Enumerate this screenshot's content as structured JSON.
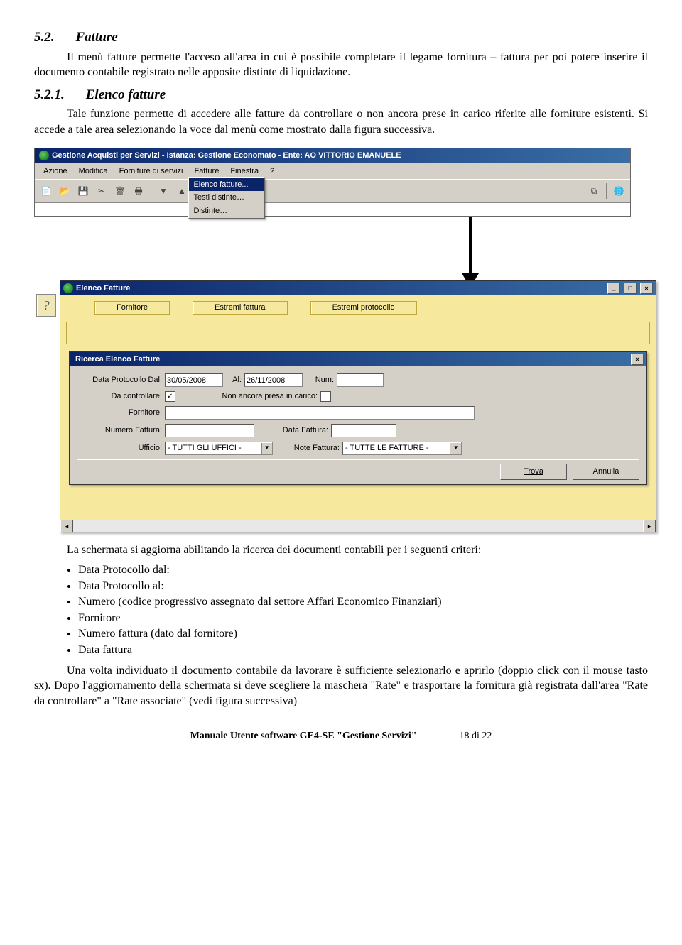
{
  "section": {
    "num": "5.2.",
    "title": "Fatture"
  },
  "para1": "Il menù fatture permette l'acceso all'area in cui è possibile completare il legame fornitura – fattura per poi potere inserire il documento contabile registrato nelle apposite distinte di liquidazione.",
  "subsection": {
    "num": "5.2.1.",
    "title": "Elenco fatture"
  },
  "para2": "Tale funzione permette di accedere alle fatture da controllare o non ancora prese in carico riferite alle forniture esistenti. Si accede a tale area selezionando la voce dal menù come mostrato dalla figura successiva.",
  "app": {
    "title": "Gestione Acquisti per Servizi - Istanza: Gestione Economato - Ente: AO VITTORIO EMANUELE ",
    "menus": [
      "Azione",
      "Modifica",
      "Forniture di servizi",
      "Fatture",
      "Finestra",
      "?"
    ],
    "dropdown": [
      "Elenco fatture...",
      "Testi distinte…",
      "Distinte…"
    ]
  },
  "elenco": {
    "title": "Elenco Fatture",
    "helpIcon": "?",
    "cols": [
      "Fornitore",
      "Estremi fattura",
      "Estremi protocollo"
    ]
  },
  "ricerca": {
    "title": "Ricerca Elenco Fatture",
    "labels": {
      "dataProtDal": "Data Protocollo Dal:",
      "al": "Al:",
      "num": "Num:",
      "daControllare": "Da controllare:",
      "nonPresa": "Non ancora presa in carico:",
      "fornitore": "Fornitore:",
      "numFattura": "Numero Fattura:",
      "dataFattura": "Data Fattura:",
      "ufficio": "Ufficio:",
      "noteFattura": "Note Fattura:"
    },
    "values": {
      "dataProtDal": "30/05/2008",
      "al": "26/11/2008",
      "num": "",
      "daControllareChecked": "✓",
      "nonPresaChecked": "",
      "fornitore": "",
      "numFattura": "",
      "dataFattura": "",
      "ufficio": "- TUTTI GLI UFFICI -",
      "noteFattura": "- TUTTE LE FATTURE -"
    },
    "btnTrova": "Trova",
    "btnAnnulla": "Annulla"
  },
  "para3": "La schermata si aggiorna abilitando la ricerca dei documenti contabili per i seguenti criteri:",
  "bullets": [
    "Data Protocollo dal:",
    "Data Protocollo al:",
    "Numero (codice progressivo assegnato dal settore Affari Economico Finanziari)",
    "Fornitore",
    "Numero fattura (dato dal fornitore)",
    "Data fattura"
  ],
  "para4a": "Una volta individuato il documento contabile da lavorare è sufficiente selezionarlo e aprirlo",
  "para4b": "(doppio click con il mouse tasto sx). Dopo l'aggiornamento della schermata si deve scegliere la maschera \"Rate\" e trasportare la fornitura già registrata dall'area \"Rate da controllare\" a \"Rate associate\" (vedi figura successiva)",
  "footer": {
    "title": "Manuale Utente software GE4-SE \"Gestione Servizi\"",
    "page": "18 di 22"
  }
}
